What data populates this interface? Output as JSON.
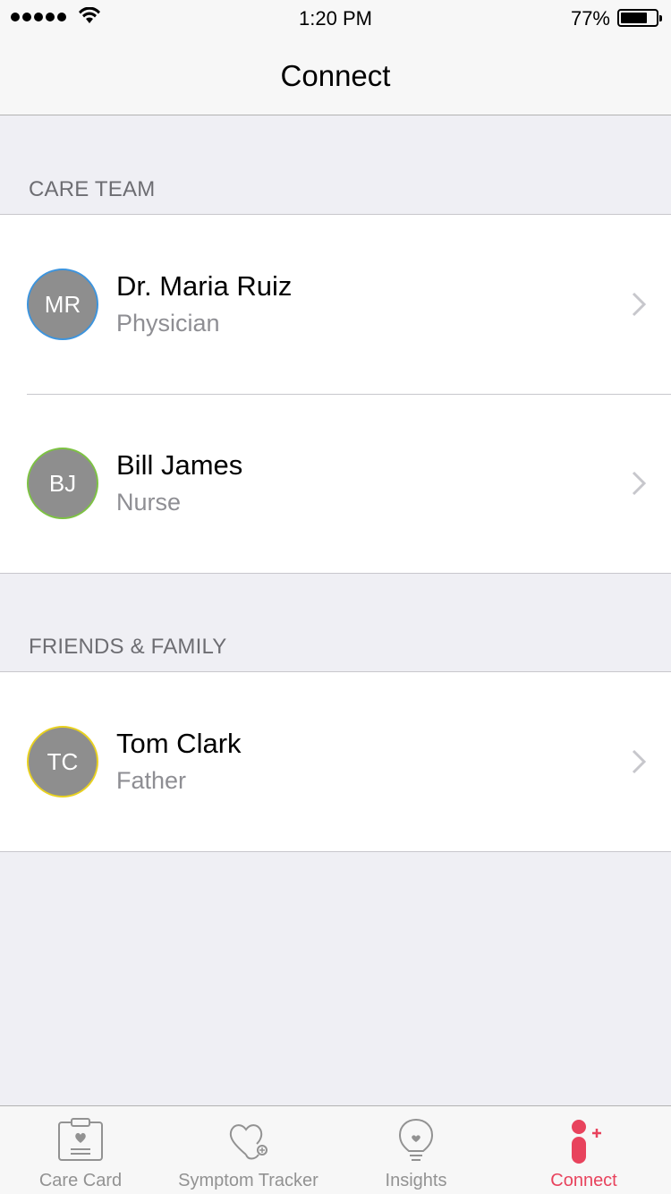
{
  "status_bar": {
    "time": "1:20 PM",
    "battery": "77%"
  },
  "nav": {
    "title": "Connect"
  },
  "sections": [
    {
      "header": "CARE TEAM",
      "contacts": [
        {
          "initials": "MR",
          "name": "Dr. Maria Ruiz",
          "role": "Physician",
          "ring_color": "#3d94dd"
        },
        {
          "initials": "BJ",
          "name": "Bill James",
          "role": "Nurse",
          "ring_color": "#7dc243"
        }
      ]
    },
    {
      "header": "FRIENDS & FAMILY",
      "contacts": [
        {
          "initials": "TC",
          "name": "Tom Clark",
          "role": "Father",
          "ring_color": "#e8d120"
        }
      ]
    }
  ],
  "tabs": [
    {
      "label": "Care Card",
      "icon": "clipboard-heart-icon",
      "active": false
    },
    {
      "label": "Symptom Tracker",
      "icon": "stethoscope-icon",
      "active": false
    },
    {
      "label": "Insights",
      "icon": "lightbulb-icon",
      "active": false
    },
    {
      "label": "Connect",
      "icon": "person-add-icon",
      "active": true
    }
  ],
  "colors": {
    "accent": "#e8435d",
    "inactive": "#929292"
  }
}
